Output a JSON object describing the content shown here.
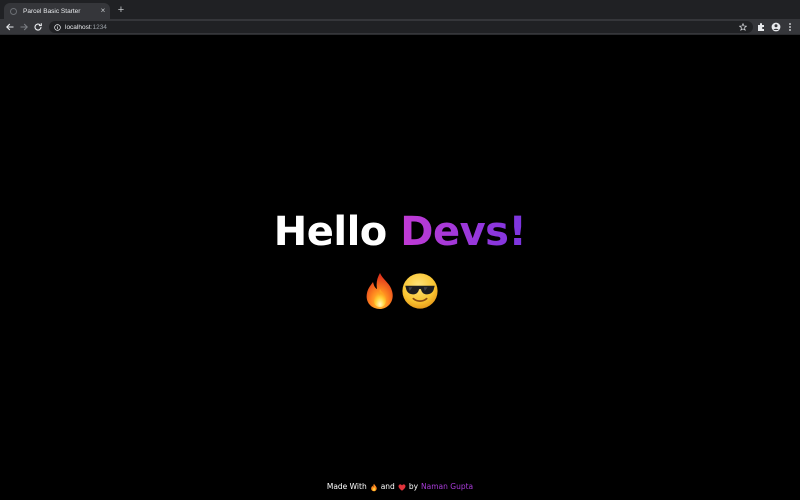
{
  "browser": {
    "tab_title": "Parcel Basic Starter",
    "tab_close": "×",
    "new_tab": "+",
    "url_host": "localhost",
    "url_port": ":1234"
  },
  "hero": {
    "greeting": "Hello",
    "highlight": "Devs!",
    "emojis": [
      "fire-emoji",
      "sunglasses-emoji"
    ]
  },
  "footer": {
    "made_with": "Made With",
    "and": "and",
    "by": "by",
    "author": "Naman Gupta"
  },
  "colors": {
    "accent_start": "#c23bd4",
    "accent_end": "#7a35e0",
    "author": "#a83bd8",
    "background": "#000000"
  }
}
